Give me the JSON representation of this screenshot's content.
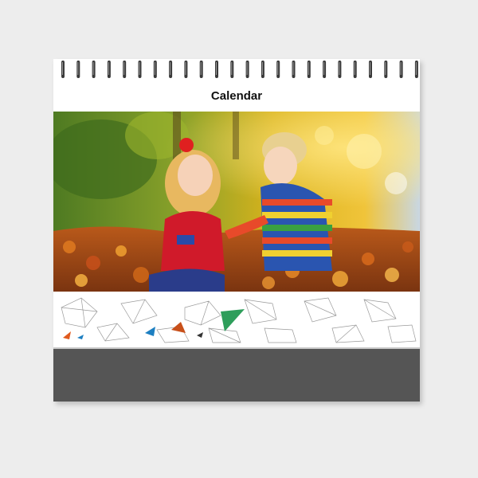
{
  "calendar": {
    "title": "Calendar"
  },
  "photo": {
    "subject": "two-children-playing-in-autumn-leaves-image"
  },
  "colors": {
    "page": "#ffffff",
    "base": "#555555",
    "background": "#ededed",
    "accent_green": "#2e9e5b",
    "accent_blue": "#1d7fc1",
    "accent_orange": "#e05a1e"
  }
}
